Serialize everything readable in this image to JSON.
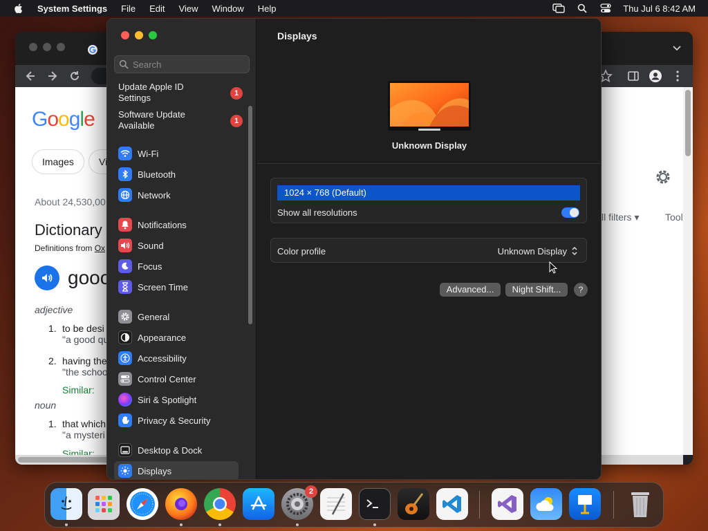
{
  "menubar": {
    "app_name": "System Settings",
    "menus": [
      "File",
      "Edit",
      "View",
      "Window",
      "Help"
    ],
    "clock": "Thu Jul 6  8:42 AM"
  },
  "browser": {
    "logo": "Google",
    "filters": [
      "Images",
      "Vi"
    ],
    "result_count": "About 24,530,00",
    "dictionary_title": "Dictionary",
    "definitions_from": "Definitions from ",
    "definitions_source": "Ox",
    "word": "gooc",
    "pos_adjective": "adjective",
    "pos_noun": "noun",
    "defs": [
      {
        "num": "1.",
        "text": "to be desi",
        "example": "\"a good qu"
      },
      {
        "num": "2.",
        "text": "having the",
        "example": "\"the schoo"
      },
      {
        "num": "1.",
        "text": "that which",
        "example": "\"a mysteri"
      }
    ],
    "similar_label": "Similar:",
    "all_filters": "ll filters",
    "tools": "Tool"
  },
  "settings": {
    "search_placeholder": "Search",
    "notices": [
      {
        "line1": "Update Apple ID",
        "line2": "Settings",
        "badge": "1"
      },
      {
        "line1": "Software Update",
        "line2": "Available",
        "badge": "1"
      }
    ],
    "sidebar_items": [
      {
        "label": "Wi-Fi",
        "icon": "wifi-icon",
        "color": "#2f7cf6"
      },
      {
        "label": "Bluetooth",
        "icon": "bluetooth-icon",
        "color": "#2f7cf6"
      },
      {
        "label": "Network",
        "icon": "globe-icon",
        "color": "#2f7cf6"
      },
      {
        "label": "Notifications",
        "icon": "bell-icon",
        "color": "#e5484d"
      },
      {
        "label": "Sound",
        "icon": "speaker-icon",
        "color": "#e5484d"
      },
      {
        "label": "Focus",
        "icon": "moon-icon",
        "color": "#5e5ce6"
      },
      {
        "label": "Screen Time",
        "icon": "hourglass-icon",
        "color": "#5e5ce6"
      },
      {
        "label": "General",
        "icon": "gear-icon",
        "color": "#8e8e93"
      },
      {
        "label": "Appearance",
        "icon": "appearance-icon",
        "color": "#1c1c1e"
      },
      {
        "label": "Accessibility",
        "icon": "accessibility-icon",
        "color": "#2f7cf6"
      },
      {
        "label": "Control Center",
        "icon": "control-center-icon",
        "color": "#8e8e93"
      },
      {
        "label": "Siri & Spotlight",
        "icon": "siri-icon",
        "color": "#bf5af2"
      },
      {
        "label": "Privacy & Security",
        "icon": "hand-icon",
        "color": "#2f7cf6"
      },
      {
        "label": "Desktop & Dock",
        "icon": "dock-icon",
        "color": "#1c1c1e"
      },
      {
        "label": "Displays",
        "icon": "sun-icon",
        "color": "#2f7cf6"
      }
    ],
    "content_title": "Displays",
    "display_name": "Unknown Display",
    "resolution": "1024 × 768 (Default)",
    "show_all_resolutions": "Show all resolutions",
    "show_all_enabled": true,
    "color_profile_label": "Color profile",
    "color_profile_value": "Unknown Display",
    "advanced_button": "Advanced...",
    "night_shift_button": "Night Shift...",
    "help_button": "?"
  },
  "dock": {
    "apps": [
      "Finder",
      "Launchpad",
      "Safari",
      "Firefox",
      "Chrome",
      "App Store",
      "System Settings",
      "TextEdit",
      "Terminal",
      "GarageBand",
      "Visual Studio Code",
      "Visual Studio",
      "Weather",
      "Keynote",
      "Trash"
    ],
    "settings_badge": "2"
  }
}
